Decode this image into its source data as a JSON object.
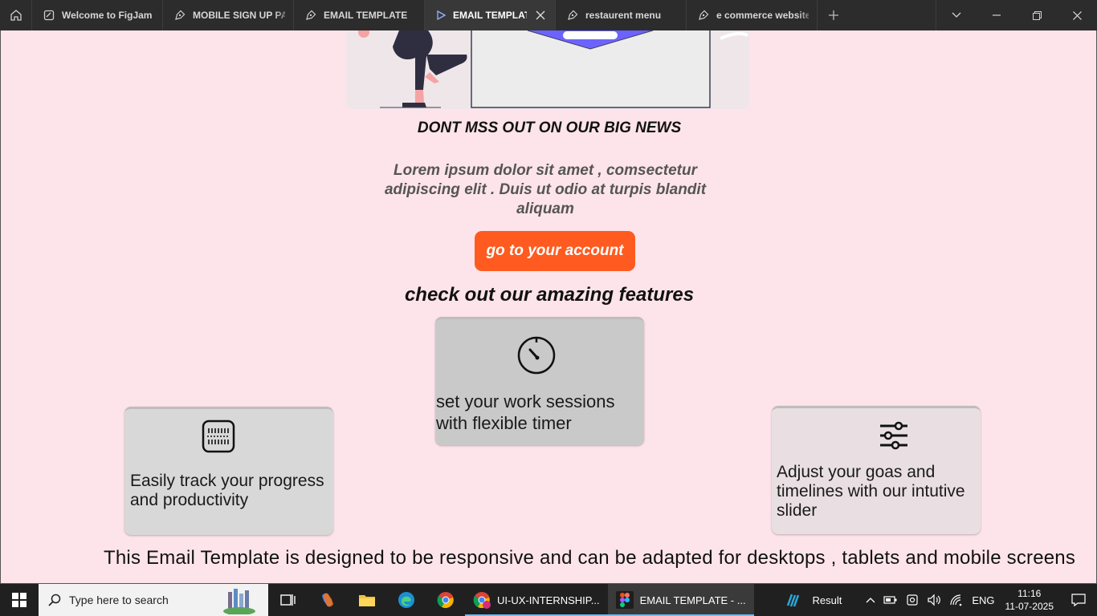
{
  "tabs": [
    {
      "label": "Welcome to FigJam",
      "icon": "figjam-icon",
      "active": false
    },
    {
      "label": "MOBILE SIGN UP PAGE",
      "icon": "pen-icon",
      "active": false
    },
    {
      "label": "EMAIL TEMPLATE",
      "icon": "pen-icon",
      "active": false
    },
    {
      "label": "EMAIL TEMPLATE",
      "icon": "play-icon",
      "active": true
    },
    {
      "label": "restaurent menu",
      "icon": "pen-icon",
      "active": false
    },
    {
      "label": "e commerce website design",
      "icon": "pen-icon",
      "active": false
    }
  ],
  "email": {
    "headline": "DONT MSS OUT ON  OUR BIG NEWS",
    "body": "Lorem ipsum dolor sit amet , comsectetur adipiscing elit . Duis ut odio at turpis blandit aliquam",
    "cta_label": "go to your account",
    "features_title": "check out our amazing features",
    "features": {
      "timer": "set your work sessions with flexible timer",
      "progress": "Easily track your progress and productivity",
      "slider": "Adjust your goas and timelines with our intutive slider"
    },
    "footer_note": "This Email Template is designed to be responsive and can be adapted for desktops , tablets and mobile screens"
  },
  "taskbar": {
    "search_placeholder": "Type here to search",
    "apps": [
      {
        "label": "UI-UX-INTERNSHIP...",
        "icon": "chrome-profile-icon"
      },
      {
        "label": "EMAIL TEMPLATE - ...",
        "icon": "figma-icon"
      }
    ],
    "weather_label": "Result",
    "language": "ENG",
    "time": "11:16",
    "date": "11-07-2025"
  },
  "colors": {
    "canvas_bg": "#fde4ea",
    "cta_bg": "#ff5a1f",
    "tabbar_bg": "#2c2c2c"
  }
}
